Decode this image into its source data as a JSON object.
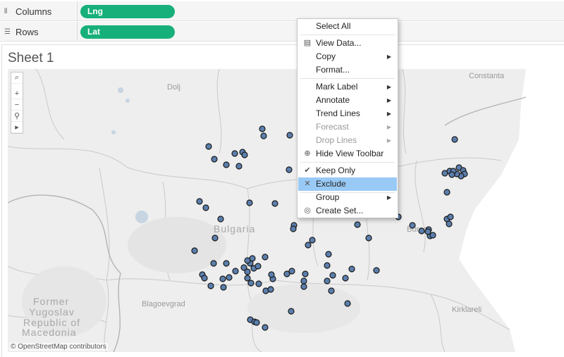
{
  "shelves": {
    "columns": {
      "label": "Columns",
      "icon": "columns-icon",
      "pill": "Lng"
    },
    "rows": {
      "label": "Rows",
      "icon": "rows-icon",
      "pill": "Lat"
    }
  },
  "sheet": {
    "title": "Sheet 1"
  },
  "map": {
    "labels": {
      "dolj": "Dolj",
      "constanta": "Constanta",
      "bulgaria": "Bulgaria",
      "burgas": "Burgas",
      "blagoevgrad": "Blagoevgrad",
      "kirklareli": "Kirklareli",
      "former": "Former",
      "yugoslav": "Yugoslav",
      "republic": "Republic of",
      "macedonia": "Macedonia"
    },
    "attribution": "© OpenStreetMap contributors",
    "mark_color": "#5b7fad",
    "mark_outline": "#1a1a1a"
  },
  "toolbar": {
    "search": "⌕",
    "zoom_in": "+",
    "zoom_out": "−",
    "pin": "⚲",
    "expand": "▸"
  },
  "context_menu": {
    "select_all": "Select All",
    "view_data": "View Data...",
    "copy": "Copy",
    "format": "Format...",
    "mark_label": "Mark Label",
    "annotate": "Annotate",
    "trend_lines": "Trend Lines",
    "forecast": "Forecast",
    "drop_lines": "Drop Lines",
    "hide_view_toolbar": "Hide View Toolbar",
    "keep_only": "Keep Only",
    "exclude": "Exclude",
    "group": "Group",
    "create_set": "Create Set...",
    "arrow": "▶",
    "icons": {
      "view_data": "▤",
      "hide_toolbar": "⊕",
      "keep_only": "✔",
      "exclude": "✕",
      "create_set": "◎"
    }
  }
}
